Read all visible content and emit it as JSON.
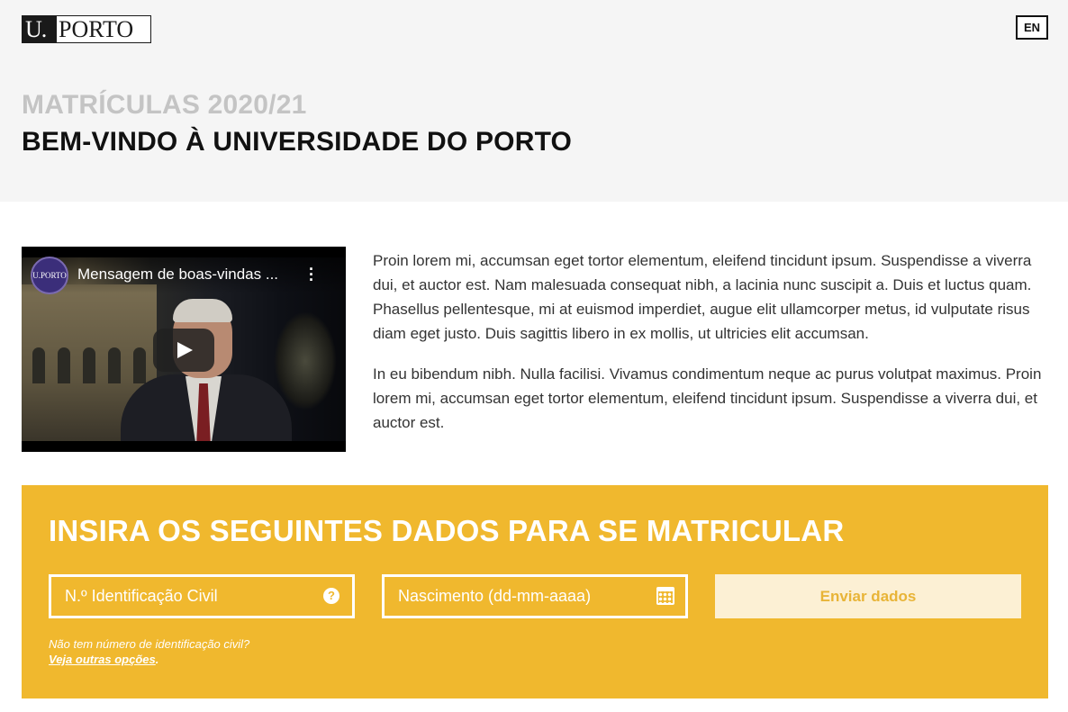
{
  "header": {
    "logo_u": "U.",
    "logo_porto": "PORTO",
    "lang_button": "EN",
    "pre_title": "MATRÍCULAS 2020/21",
    "title": "BEM-VINDO À UNIVERSIDADE DO PORTO"
  },
  "video": {
    "channel_avatar_text": "U.PORTO",
    "title": "Mensagem de boas-vindas ...",
    "menu_icon": "more-vert-icon",
    "play_icon": "play-icon"
  },
  "content": {
    "paragraph_1": "Proin lorem mi, accumsan eget tortor elementum, eleifend tincidunt ipsum. Suspendisse a viverra dui, et auctor est. Nam malesuada consequat nibh, a lacinia nunc suscipit a. Duis et luctus quam. Phasellus pellentesque, mi at euismod imperdiet, augue elit ullamcorper metus, id vulputate risus diam eget justo. Duis sagittis libero in ex mollis, ut ultricies elit accumsan.",
    "paragraph_2": "In eu bibendum nibh. Nulla facilisi. Vivamus condimentum neque ac purus volutpat maximus. Proin lorem mi, accumsan eget tortor elementum, eleifend tincidunt ipsum. Suspendisse a viverra dui, et auctor est."
  },
  "form": {
    "title": "INSIRA OS SEGUINTES DADOS PARA SE MATRICULAR",
    "id_placeholder": "N.º Identificação Civil",
    "id_help_icon": "?",
    "birth_placeholder": "Nascimento (dd-mm-aaaa)",
    "birth_icon": "calendar-icon",
    "submit_label": "Enviar dados",
    "no_id_text": "Não tem número de identificação civil?",
    "other_options_link": "Veja outras opções",
    "other_options_suffix": "."
  },
  "colors": {
    "accent": "#f0b82e",
    "header_bg": "#f5f5f5",
    "submit_bg": "#fcf0d4"
  }
}
